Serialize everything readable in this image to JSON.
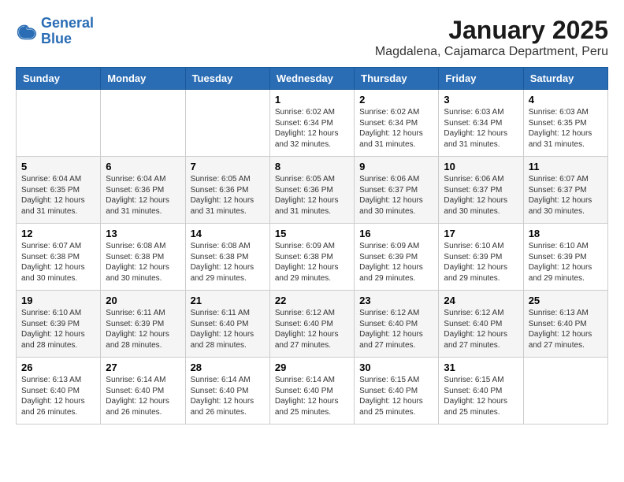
{
  "logo": {
    "line1": "General",
    "line2": "Blue"
  },
  "header": {
    "month": "January 2025",
    "location": "Magdalena, Cajamarca Department, Peru"
  },
  "weekdays": [
    "Sunday",
    "Monday",
    "Tuesday",
    "Wednesday",
    "Thursday",
    "Friday",
    "Saturday"
  ],
  "weeks": [
    [
      {
        "day": null,
        "info": null
      },
      {
        "day": null,
        "info": null
      },
      {
        "day": null,
        "info": null
      },
      {
        "day": "1",
        "info": "Sunrise: 6:02 AM\nSunset: 6:34 PM\nDaylight: 12 hours\nand 32 minutes."
      },
      {
        "day": "2",
        "info": "Sunrise: 6:02 AM\nSunset: 6:34 PM\nDaylight: 12 hours\nand 31 minutes."
      },
      {
        "day": "3",
        "info": "Sunrise: 6:03 AM\nSunset: 6:34 PM\nDaylight: 12 hours\nand 31 minutes."
      },
      {
        "day": "4",
        "info": "Sunrise: 6:03 AM\nSunset: 6:35 PM\nDaylight: 12 hours\nand 31 minutes."
      }
    ],
    [
      {
        "day": "5",
        "info": "Sunrise: 6:04 AM\nSunset: 6:35 PM\nDaylight: 12 hours\nand 31 minutes."
      },
      {
        "day": "6",
        "info": "Sunrise: 6:04 AM\nSunset: 6:36 PM\nDaylight: 12 hours\nand 31 minutes."
      },
      {
        "day": "7",
        "info": "Sunrise: 6:05 AM\nSunset: 6:36 PM\nDaylight: 12 hours\nand 31 minutes."
      },
      {
        "day": "8",
        "info": "Sunrise: 6:05 AM\nSunset: 6:36 PM\nDaylight: 12 hours\nand 31 minutes."
      },
      {
        "day": "9",
        "info": "Sunrise: 6:06 AM\nSunset: 6:37 PM\nDaylight: 12 hours\nand 30 minutes."
      },
      {
        "day": "10",
        "info": "Sunrise: 6:06 AM\nSunset: 6:37 PM\nDaylight: 12 hours\nand 30 minutes."
      },
      {
        "day": "11",
        "info": "Sunrise: 6:07 AM\nSunset: 6:37 PM\nDaylight: 12 hours\nand 30 minutes."
      }
    ],
    [
      {
        "day": "12",
        "info": "Sunrise: 6:07 AM\nSunset: 6:38 PM\nDaylight: 12 hours\nand 30 minutes."
      },
      {
        "day": "13",
        "info": "Sunrise: 6:08 AM\nSunset: 6:38 PM\nDaylight: 12 hours\nand 30 minutes."
      },
      {
        "day": "14",
        "info": "Sunrise: 6:08 AM\nSunset: 6:38 PM\nDaylight: 12 hours\nand 29 minutes."
      },
      {
        "day": "15",
        "info": "Sunrise: 6:09 AM\nSunset: 6:38 PM\nDaylight: 12 hours\nand 29 minutes."
      },
      {
        "day": "16",
        "info": "Sunrise: 6:09 AM\nSunset: 6:39 PM\nDaylight: 12 hours\nand 29 minutes."
      },
      {
        "day": "17",
        "info": "Sunrise: 6:10 AM\nSunset: 6:39 PM\nDaylight: 12 hours\nand 29 minutes."
      },
      {
        "day": "18",
        "info": "Sunrise: 6:10 AM\nSunset: 6:39 PM\nDaylight: 12 hours\nand 29 minutes."
      }
    ],
    [
      {
        "day": "19",
        "info": "Sunrise: 6:10 AM\nSunset: 6:39 PM\nDaylight: 12 hours\nand 28 minutes."
      },
      {
        "day": "20",
        "info": "Sunrise: 6:11 AM\nSunset: 6:39 PM\nDaylight: 12 hours\nand 28 minutes."
      },
      {
        "day": "21",
        "info": "Sunrise: 6:11 AM\nSunset: 6:40 PM\nDaylight: 12 hours\nand 28 minutes."
      },
      {
        "day": "22",
        "info": "Sunrise: 6:12 AM\nSunset: 6:40 PM\nDaylight: 12 hours\nand 27 minutes."
      },
      {
        "day": "23",
        "info": "Sunrise: 6:12 AM\nSunset: 6:40 PM\nDaylight: 12 hours\nand 27 minutes."
      },
      {
        "day": "24",
        "info": "Sunrise: 6:12 AM\nSunset: 6:40 PM\nDaylight: 12 hours\nand 27 minutes."
      },
      {
        "day": "25",
        "info": "Sunrise: 6:13 AM\nSunset: 6:40 PM\nDaylight: 12 hours\nand 27 minutes."
      }
    ],
    [
      {
        "day": "26",
        "info": "Sunrise: 6:13 AM\nSunset: 6:40 PM\nDaylight: 12 hours\nand 26 minutes."
      },
      {
        "day": "27",
        "info": "Sunrise: 6:14 AM\nSunset: 6:40 PM\nDaylight: 12 hours\nand 26 minutes."
      },
      {
        "day": "28",
        "info": "Sunrise: 6:14 AM\nSunset: 6:40 PM\nDaylight: 12 hours\nand 26 minutes."
      },
      {
        "day": "29",
        "info": "Sunrise: 6:14 AM\nSunset: 6:40 PM\nDaylight: 12 hours\nand 25 minutes."
      },
      {
        "day": "30",
        "info": "Sunrise: 6:15 AM\nSunset: 6:40 PM\nDaylight: 12 hours\nand 25 minutes."
      },
      {
        "day": "31",
        "info": "Sunrise: 6:15 AM\nSunset: 6:40 PM\nDaylight: 12 hours\nand 25 minutes."
      },
      {
        "day": null,
        "info": null
      }
    ]
  ]
}
